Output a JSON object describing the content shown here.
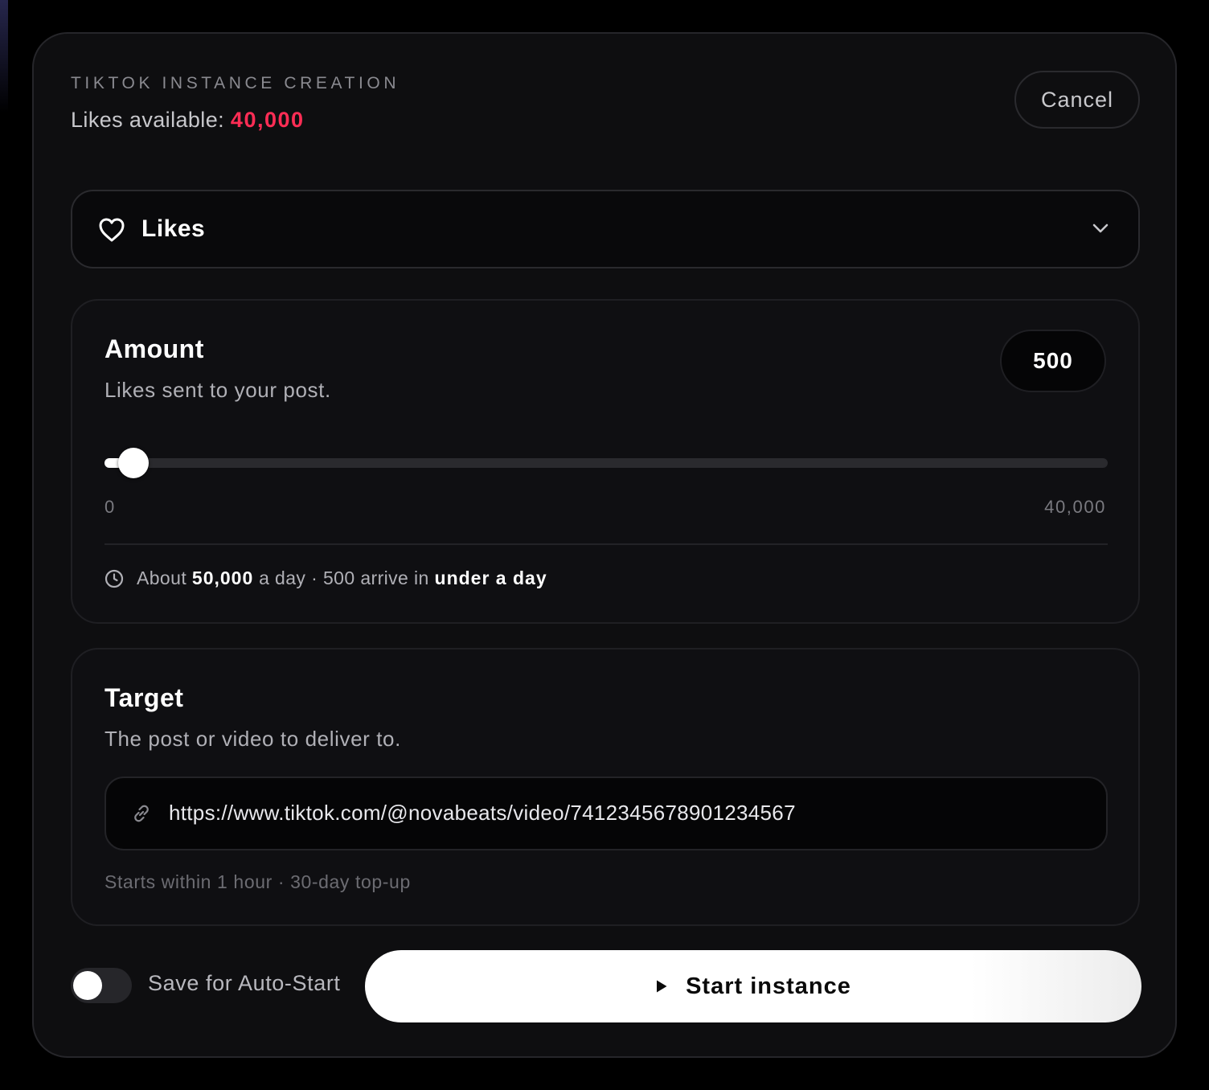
{
  "header": {
    "eyebrow": "TIKTOK INSTANCE CREATION",
    "available_label": "Likes available:",
    "available_value": "40,000",
    "cancel_label": "Cancel"
  },
  "service_select": {
    "icon": "heart-icon",
    "selected": "Likes",
    "chevron_icon": "chevron-down-icon"
  },
  "amount_card": {
    "title": "Amount",
    "subtitle": "Likes sent to your post.",
    "value": "500",
    "slider": {
      "min_label": "0",
      "max_label": "40,000",
      "value": 500,
      "min": 0,
      "max": 40000
    },
    "eta": {
      "icon": "clock-icon",
      "prefix": "About",
      "rate": "50,000",
      "mid": "a day · 500 arrive in",
      "duration": "under a day"
    }
  },
  "target_card": {
    "title": "Target",
    "subtitle": "The post or video to deliver to.",
    "link_icon": "link-icon",
    "url_value": "https://www.tiktok.com/@novabeats/video/7412345678901234567",
    "note": "Starts within 1 hour · 30-day top-up"
  },
  "footer": {
    "toggle_label": "Save for Auto-Start",
    "toggle_on": false,
    "start_icon": "play-icon",
    "start_label": "Start instance"
  },
  "colors": {
    "accent": "#ff2d55",
    "panel_bg": "#0e0e10",
    "page_bg": "#000000"
  }
}
